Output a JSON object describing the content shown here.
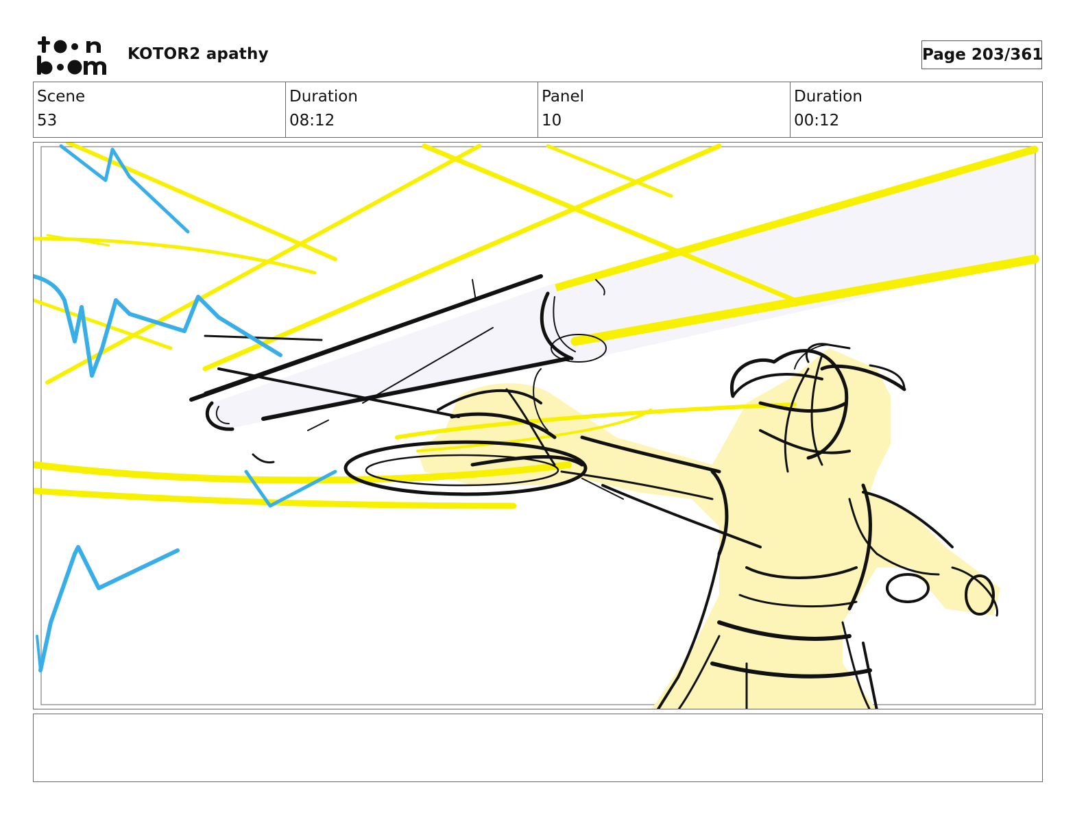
{
  "header": {
    "logo_text": "toon boom",
    "project_title": "KOTOR2 apathy",
    "page_indicator": "Page 203/361"
  },
  "info": {
    "scene_label": "Scene",
    "scene_value": "53",
    "scene_duration_label": "Duration",
    "scene_duration_value": "08:12",
    "panel_label": "Panel",
    "panel_value": "10",
    "panel_duration_label": "Duration",
    "panel_duration_value": "00:12"
  },
  "notes": {
    "text": ""
  },
  "colors": {
    "beam_yellow": "#f7f000",
    "lightning_blue": "#38aee8",
    "skin_fill": "#fdf5b8",
    "barrel_fill": "#f6f4fb",
    "ink": "#111111"
  }
}
